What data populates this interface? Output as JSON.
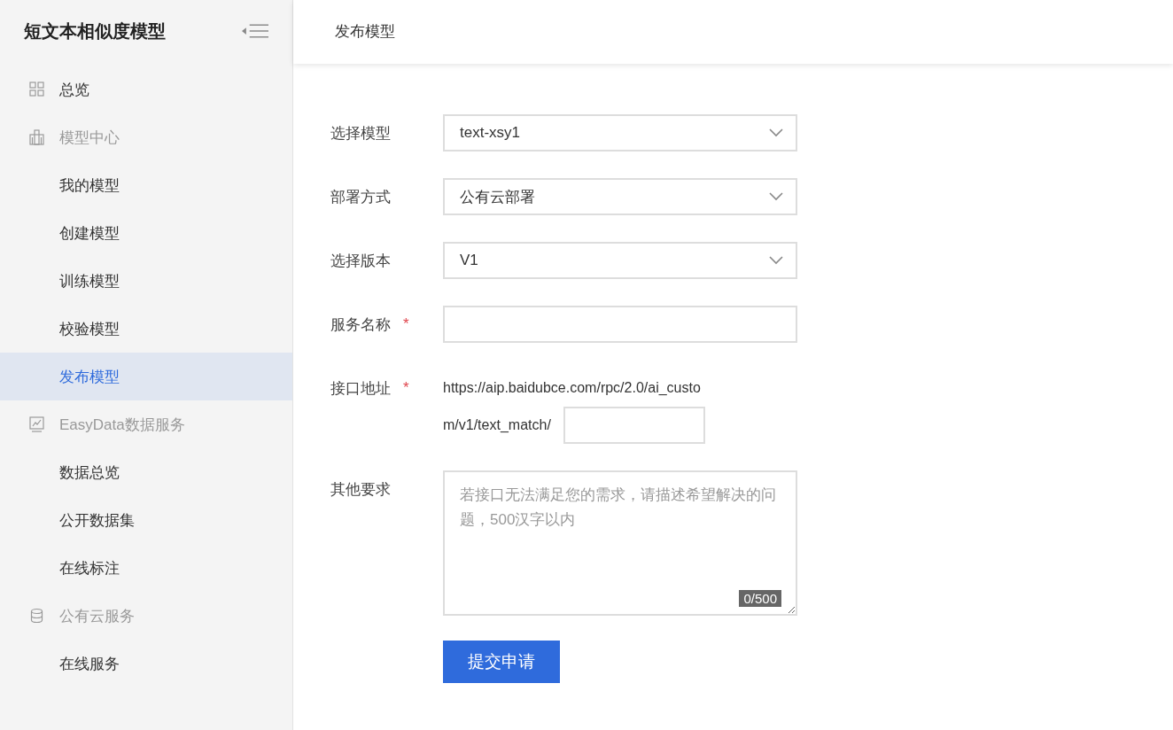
{
  "sidebar": {
    "title": "短文本相似度模型",
    "items": [
      {
        "kind": "link",
        "label": "总览",
        "selected": false
      },
      {
        "kind": "group",
        "label": "模型中心",
        "children": [
          {
            "kind": "link",
            "label": "我的模型",
            "selected": false
          },
          {
            "kind": "link",
            "label": "创建模型",
            "selected": false
          },
          {
            "kind": "link",
            "label": "训练模型",
            "selected": false
          },
          {
            "kind": "link",
            "label": "校验模型",
            "selected": false
          },
          {
            "kind": "link",
            "label": "发布模型",
            "selected": true
          }
        ]
      },
      {
        "kind": "group",
        "label": "EasyData数据服务",
        "children": [
          {
            "kind": "link",
            "label": "数据总览",
            "selected": false
          },
          {
            "kind": "link",
            "label": "公开数据集",
            "selected": false
          },
          {
            "kind": "link",
            "label": "在线标注",
            "selected": false
          }
        ]
      },
      {
        "kind": "group",
        "label": "公有云服务",
        "children": [
          {
            "kind": "link",
            "label": "在线服务",
            "selected": false
          }
        ]
      }
    ]
  },
  "header": {
    "title": "发布模型"
  },
  "form": {
    "fields": [
      {
        "kind": "select",
        "label": "选择模型",
        "value": "text-xsy1"
      },
      {
        "kind": "select",
        "label": "部署方式",
        "value": "公有云部署"
      },
      {
        "kind": "select",
        "label": "选择版本",
        "value": "V1"
      },
      {
        "kind": "text",
        "label": "服务名称",
        "required_mark": "*"
      },
      {
        "kind": "url",
        "label": "接口地址",
        "required_mark": "*",
        "prefix_lines": [
          "https://aip.baidubce.com/rpc/2.0/ai_custo",
          "m/v1/text_match/"
        ]
      },
      {
        "kind": "textarea",
        "label": "其他要求",
        "placeholder": "若接口无法满足您的需求，请描述希望解决的问题，500汉字以内",
        "counter": "0/500"
      }
    ],
    "submit": "提交申请"
  }
}
